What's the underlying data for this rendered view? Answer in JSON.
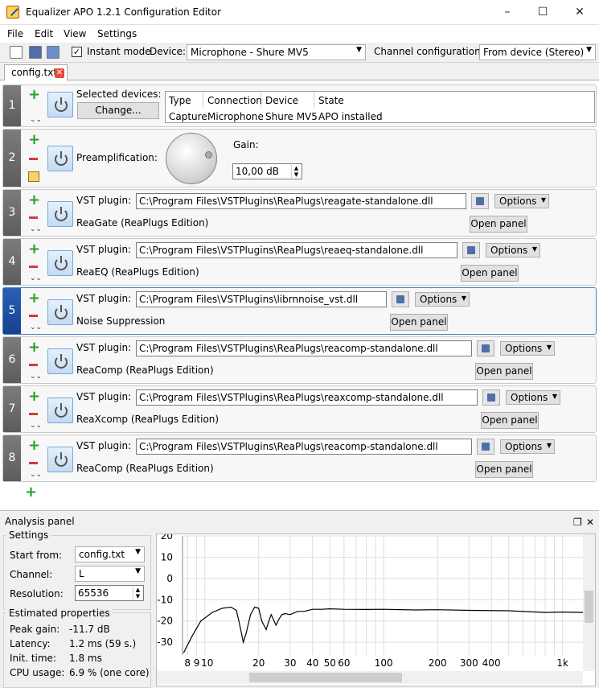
{
  "window": {
    "title": "Equalizer APO 1.2.1 Configuration Editor"
  },
  "menu": [
    "File",
    "Edit",
    "View",
    "Settings"
  ],
  "toolbar": {
    "instant_mode_label": "Instant mode",
    "instant_mode_checked": true,
    "device_label": "Device:",
    "device_value": "Microphone - Shure MV5",
    "channel_label": "Channel configuration:",
    "channel_value": "From device (Stereo)"
  },
  "tab": {
    "label": "config.txt"
  },
  "row1": {
    "num": "1",
    "selected_label": "Selected devices:",
    "change_label": "Change...",
    "headers": [
      "Type",
      "Connection",
      "Device",
      "State"
    ],
    "values": [
      "Capture",
      "Microphone",
      "Shure MV5",
      "APO installed"
    ]
  },
  "row2": {
    "num": "2",
    "preamp_label": "Preamplification:",
    "gain_label": "Gain:",
    "gain_value": "10,00 dB"
  },
  "vst_rows": [
    {
      "num": "3",
      "label": "VST plugin:",
      "path": "C:\\Program Files\\VSTPlugins\\ReaPlugs\\reagate-standalone.dll",
      "name": "ReaGate (ReaPlugs Edition)",
      "options": "Options",
      "open": "Open panel"
    },
    {
      "num": "4",
      "label": "VST plugin:",
      "path": "C:\\Program Files\\VSTPlugins\\ReaPlugs\\reaeq-standalone.dll",
      "name": "ReaEQ (ReaPlugs Edition)",
      "options": "Options",
      "open": "Open panel"
    },
    {
      "num": "5",
      "label": "VST plugin:",
      "path": "C:\\Program Files\\VSTPlugins\\librnnoise_vst.dll",
      "name": "Noise Suppression",
      "options": "Options",
      "open": "Open panel"
    },
    {
      "num": "6",
      "label": "VST plugin:",
      "path": "C:\\Program Files\\VSTPlugins\\ReaPlugs\\reacomp-standalone.dll",
      "name": "ReaComp (ReaPlugs Edition)",
      "options": "Options",
      "open": "Open panel"
    },
    {
      "num": "7",
      "label": "VST plugin:",
      "path": "C:\\Program Files\\VSTPlugins\\ReaPlugs\\reaxcomp-standalone.dll",
      "name": "ReaXcomp (ReaPlugs Edition)",
      "options": "Options",
      "open": "Open panel"
    },
    {
      "num": "8",
      "label": "VST plugin:",
      "path": "C:\\Program Files\\VSTPlugins\\ReaPlugs\\reacomp-standalone.dll",
      "name": "ReaComp (ReaPlugs Edition)",
      "options": "Options",
      "open": "Open panel"
    }
  ],
  "analysis": {
    "title": "Analysis panel",
    "settings_title": "Settings",
    "start_label": "Start from:",
    "start_value": "config.txt",
    "channel_label": "Channel:",
    "channel_value": "L",
    "resolution_label": "Resolution:",
    "resolution_value": "65536",
    "estim_title": "Estimated properties",
    "peak_label": "Peak gain:",
    "peak_value": "-11.7 dB",
    "latency_label": "Latency:",
    "latency_value": "1.2 ms (59 s.)",
    "init_label": "Init. time:",
    "init_value": "1.8 ms",
    "cpu_label": "CPU usage:",
    "cpu_value": "6.9 % (one core)"
  },
  "chart_data": {
    "type": "line",
    "x_scale": "log",
    "xlim": [
      7.5,
      1300
    ],
    "ylim": [
      -36,
      20
    ],
    "yticks": [
      20,
      10,
      0,
      -10,
      -20,
      -30
    ],
    "ytick_labels": [
      "20",
      "10",
      "0",
      "-10",
      "-20",
      "-30"
    ],
    "xticks": [
      8,
      9,
      10,
      20,
      30,
      40,
      50,
      60,
      100,
      200,
      300,
      400,
      1000
    ],
    "xtick_labels": [
      "8",
      "9",
      "10",
      "20",
      "30",
      "40",
      "50",
      "60",
      "100",
      "200",
      "300",
      "400",
      "1k"
    ],
    "grid": true,
    "x": [
      7.6,
      8.5,
      9.5,
      11,
      12.5,
      14,
      15,
      15.6,
      16.4,
      17,
      18,
      19,
      20,
      20.8,
      22,
      23,
      23.5,
      25,
      26,
      27,
      28,
      30,
      33,
      36,
      40,
      45,
      50,
      60,
      80,
      100,
      150,
      200,
      300,
      500,
      800,
      1000,
      1300
    ],
    "y": [
      -35,
      -27,
      -20,
      -16,
      -14,
      -13.5,
      -15,
      -21,
      -30,
      -26,
      -17,
      -13.5,
      -14,
      -20,
      -24,
      -19,
      -17,
      -22,
      -19,
      -17,
      -16.5,
      -17,
      -15.5,
      -15.5,
      -14.5,
      -14.5,
      -14.3,
      -14.5,
      -14.6,
      -14.5,
      -14.8,
      -14.7,
      -15,
      -15.2,
      -16,
      -15.8,
      -16
    ]
  }
}
